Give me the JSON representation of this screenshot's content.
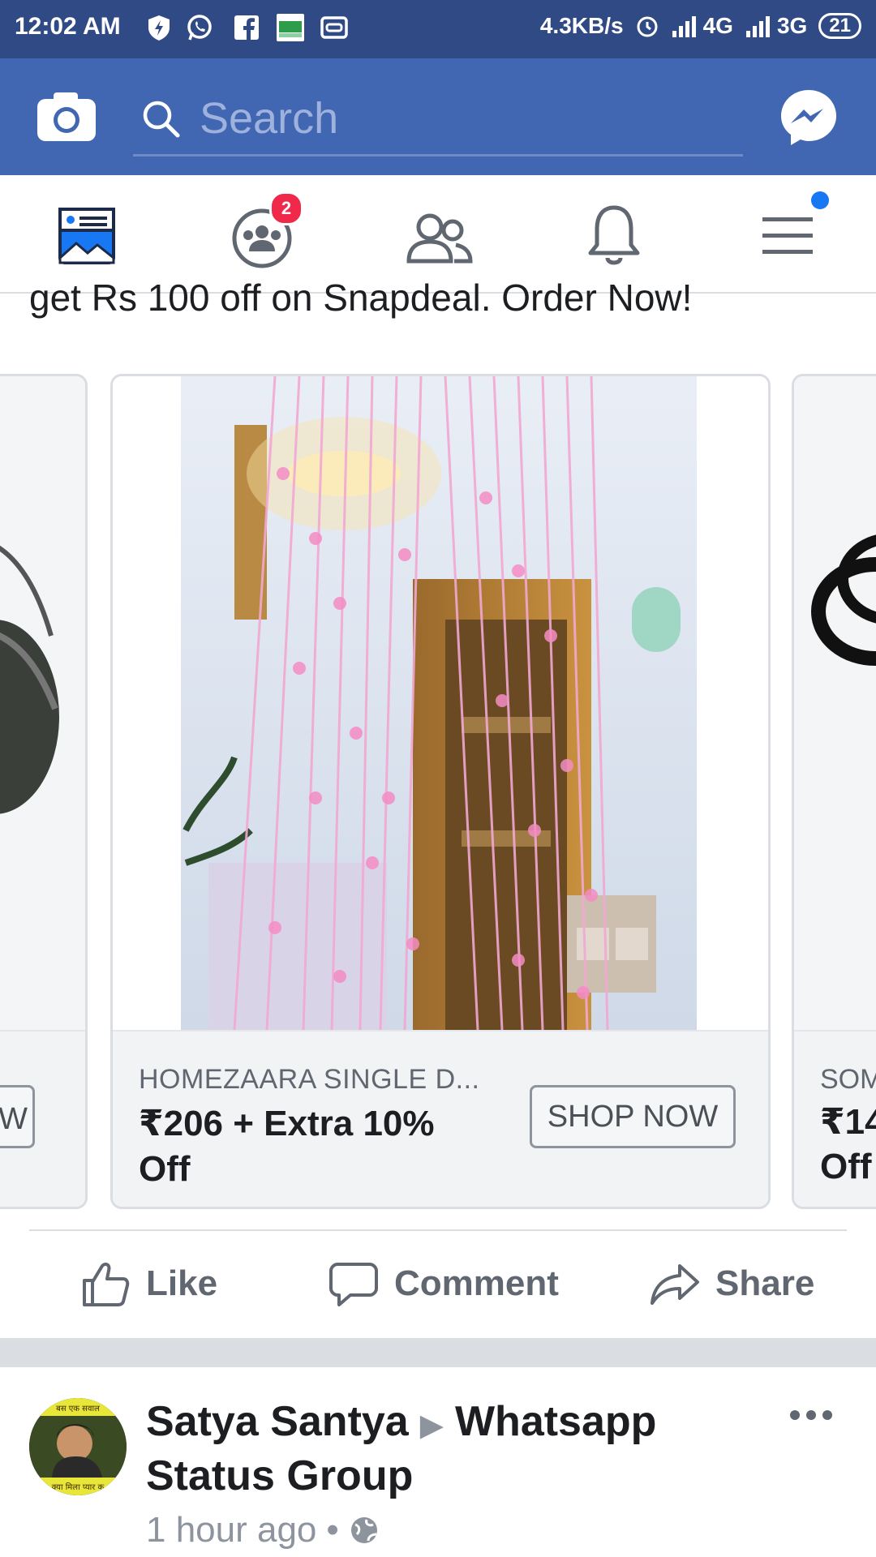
{
  "status_bar": {
    "time": "12:02 AM",
    "icons": [
      "shield-bolt-icon",
      "whatsapp-icon",
      "facebook-icon",
      "indiabulls-partner-icon",
      "cast-icon"
    ],
    "net_speed": "4.3KB/s",
    "network_1": "4G",
    "network_2": "3G",
    "battery": "21"
  },
  "app_bar": {
    "search_placeholder": "Search",
    "camera_icon": "camera-icon",
    "messenger_icon": "messenger-icon"
  },
  "tabs": [
    {
      "name": "news-feed",
      "icon": "news-feed-icon",
      "active": true
    },
    {
      "name": "groups",
      "icon": "groups-icon",
      "badge": "2"
    },
    {
      "name": "friends",
      "icon": "friends-icon"
    },
    {
      "name": "notifications",
      "icon": "bell-icon"
    },
    {
      "name": "menu",
      "icon": "hamburger-icon",
      "dot": true
    }
  ],
  "feed": {
    "headline": "get Rs 100 off on Snapdeal. Order Now!",
    "cards": [
      {
        "title": "",
        "price": "",
        "cta": "OW",
        "image": "sunglasses"
      },
      {
        "title": "HOMEZAARA SINGLE D...",
        "price": "₹206 + Extra 10% Off",
        "cta": "SHOP NOW",
        "image": "pink heart curtain"
      },
      {
        "title": "SOM",
        "price": "₹14",
        "price2": "Off",
        "cta": "",
        "image": "black rings"
      }
    ],
    "actions": {
      "like": "Like",
      "comment": "Comment",
      "share": "Share"
    }
  },
  "post": {
    "author": "Satya Santya",
    "group": "Whatsapp Status Group",
    "time": "1 hour ago",
    "privacy_icon": "globe-icon",
    "avatar_text_top": "बस एक सवाल",
    "avatar_text_bottom": "क्या मिला प्यार क"
  },
  "colors": {
    "status_bar": "#304a86",
    "app_bar": "#4267b2",
    "accent": "#1877f2",
    "badge": "#f02849"
  }
}
